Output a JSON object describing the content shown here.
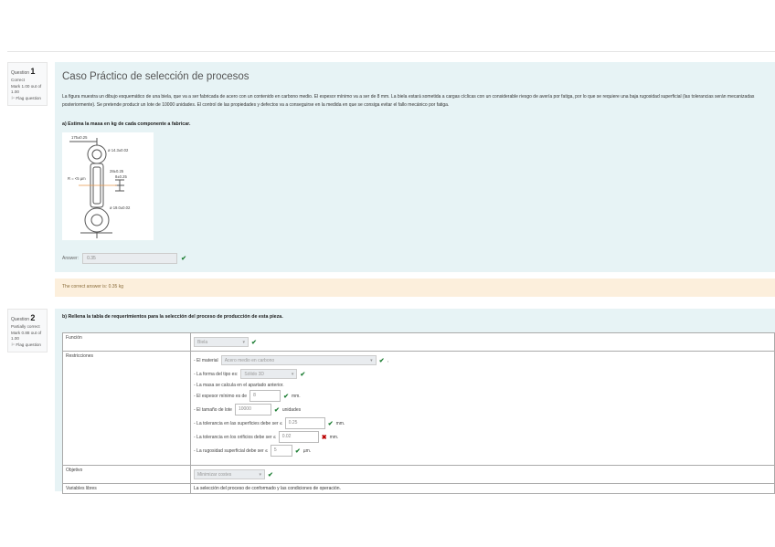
{
  "q1": {
    "label": "Question",
    "number": "1",
    "state": "Correct",
    "mark": "Mark 1.00 out of 1.00",
    "flag": "Flag question",
    "title": "Caso Práctico de selección de procesos",
    "statement": "La figura muestra un dibujo esquemático de una biela, que va a ser fabricada de acero con un contenido en carbono medio. El espesor mínimo va a ser de 8 mm. La biela estará sometida a cargas cíclicas con un considerable riesgo de avería por fatiga, por lo que se requiere una baja rugosidad superficial (las tolerancias serán mecanizadas posteriormente). Se pretende producir un lote de 10000 unidades. El control de las propiedades y defectos va a conseguirse en la medida en que se consiga evitar el fallo mecánico por fatiga.",
    "question": "a) Estima la masa en kg de cada componente a fabricar.",
    "figure_labels": [
      "175±0.25",
      "ø 14.3±0.02",
      "28±0.25",
      "R = <5 µm",
      "8±0.25",
      "ø 19.0±0.02"
    ],
    "answer_label": "Answer:",
    "answer_value": "0.35",
    "feedback": "The correct answer is: 0.35 kg"
  },
  "q2": {
    "label": "Question",
    "number": "2",
    "state": "Partially correct",
    "mark": "Mark 0.88 out of 1.00",
    "flag": "Flag question",
    "question": "b) Rellena la tabla de requerimientos para la selección del proceso de producción de esta pieza.",
    "rows": {
      "funcion": "Función",
      "restricciones": "Restricciones",
      "objetivo": "Objetivo",
      "variables": "Variables libres"
    },
    "funcion_value": "Biela",
    "objetivo_value": "Minimizar costes",
    "variables_value": "La selección del proceso de conformado y las condiciones de operación.",
    "r1a": "- El material",
    "r1v": "Acero medio en carbono",
    "r1b": ",",
    "r2a": "- La forma del tipo es:",
    "r2v": "Sólido 3D",
    "r3": "- La masa se calcula en el apartado anterior.",
    "r4a": "- El espesor mínimo es de",
    "r4v": "8",
    "r4b": "mm.",
    "r5a": "- El tamaño de lote",
    "r5v": "10000",
    "r5b": "unidades",
    "r6a": "- La tolerancia en las superficies debe ser ≤",
    "r6v": "0.25",
    "r6b": "mm.",
    "r7a": "- La tolerancia en los orificios debe ser ≤",
    "r7v": "0.02",
    "r7b": "mm.",
    "r8a": "- La rugosidad superficial debe ser ≤",
    "r8v": "5",
    "r8b": "µm."
  },
  "icons": {
    "check": "✔",
    "cross": "✖",
    "caret": "▾",
    "flag": "⚐"
  }
}
